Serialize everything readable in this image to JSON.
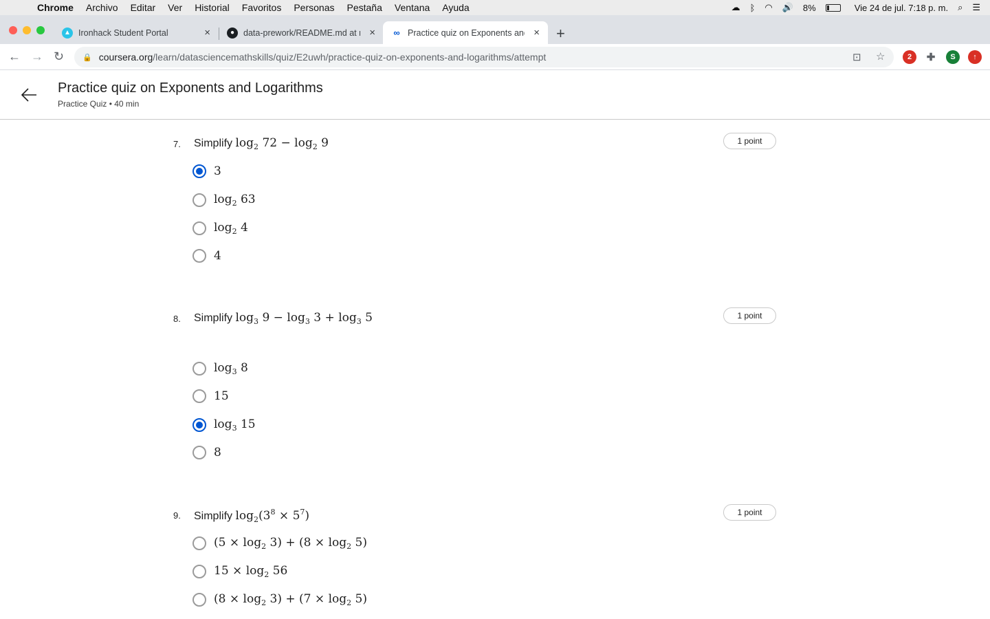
{
  "menubar": {
    "app": "Chrome",
    "items": [
      "Archivo",
      "Editar",
      "Ver",
      "Historial",
      "Favoritos",
      "Personas",
      "Pestaña",
      "Ventana",
      "Ayuda"
    ],
    "battery": "8%",
    "clock": "Vie 24 de jul.  7:18 p. m."
  },
  "tabs": [
    {
      "title": "Ironhack Student Portal",
      "icon": "ironhack-icon"
    },
    {
      "title": "data-prework/README.md at m",
      "icon": "github-icon"
    },
    {
      "title": "Practice quiz on Exponents and",
      "icon": "coursera-icon"
    }
  ],
  "address": {
    "domain": "coursera.org",
    "path": "/learn/datasciencemathskills/quiz/E2uwh/practice-quiz-on-exponents-and-logarithms/attempt"
  },
  "extensions": {
    "badge_count": "2",
    "profile_initial": "S"
  },
  "header": {
    "title": "Practice quiz on Exponents and Logarithms",
    "subtitle": "Practice Quiz • 40 min"
  },
  "questions": [
    {
      "number": "7.",
      "prefix": "Simplify",
      "points": "1 point",
      "options": [
        {
          "selected": true
        },
        {
          "selected": false
        },
        {
          "selected": false
        },
        {
          "selected": false
        }
      ]
    },
    {
      "number": "8.",
      "prefix": "Simplify",
      "points": "1 point",
      "options": [
        {
          "selected": false
        },
        {
          "selected": false
        },
        {
          "selected": true
        },
        {
          "selected": false
        }
      ]
    },
    {
      "number": "9.",
      "prefix": "Simplify",
      "points": "1 point",
      "options": [
        {
          "selected": false
        },
        {
          "selected": false
        },
        {
          "selected": false
        }
      ]
    }
  ],
  "math": {
    "log": "log",
    "minus": "−",
    "plus": "+",
    "times": "×",
    "b2": "2",
    "b3": "3",
    "n72": "72",
    "n9": "9",
    "n3": "3",
    "n5": "5",
    "n63": "63",
    "n4": "4",
    "n8": "8",
    "n15": "15",
    "n7": "7",
    "n56": "56",
    "lp": "(",
    "rp": ")"
  },
  "colors": {
    "accent": "#0056d2",
    "tabstrip": "#dee1e6"
  }
}
